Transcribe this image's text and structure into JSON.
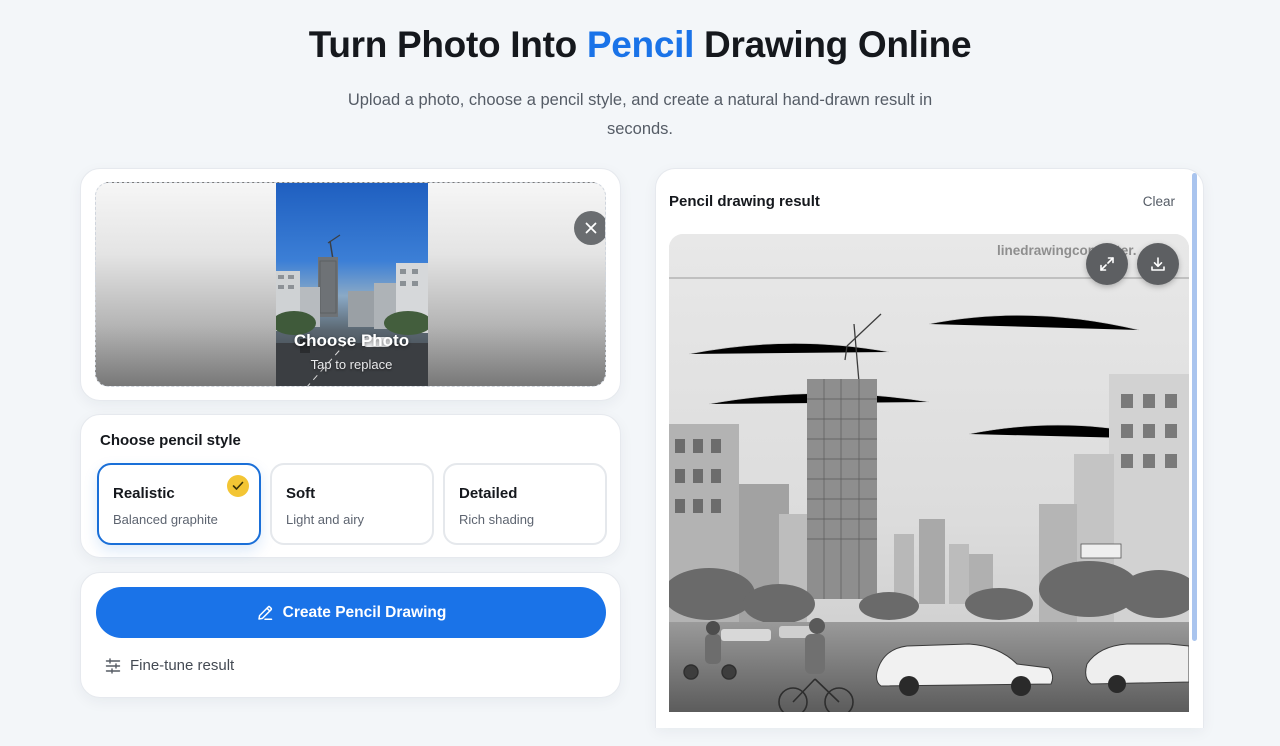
{
  "hero": {
    "title_pre": "Turn Photo Into ",
    "title_accent": "Pencil",
    "title_post": " Drawing Online",
    "subtitle": "Upload a photo, choose a pencil style, and create a natural hand-drawn result in seconds."
  },
  "upload": {
    "choose_label": "Choose Photo",
    "choose_sub": "Tap to replace",
    "remove_icon": "close-icon"
  },
  "styles": {
    "title": "Choose pencil style",
    "options": [
      {
        "name": "Realistic",
        "desc": "Balanced graphite",
        "selected": true
      },
      {
        "name": "Soft",
        "desc": "Light and airy",
        "selected": false
      },
      {
        "name": "Detailed",
        "desc": "Rich shading",
        "selected": false
      }
    ]
  },
  "actions": {
    "create_label": "Create Pencil Drawing",
    "create_icon": "pencil-icon",
    "finetune_label": "Fine-tune result",
    "finetune_icon": "sliders-icon"
  },
  "result": {
    "title": "Pencil drawing result",
    "clear_label": "Clear",
    "watermark": "linedrawingconverter.",
    "expand_icon": "expand-icon",
    "download_icon": "download-icon"
  },
  "colors": {
    "accent": "#1a73e8",
    "check_badge": "#f3c534",
    "background": "#f3f6f9"
  }
}
